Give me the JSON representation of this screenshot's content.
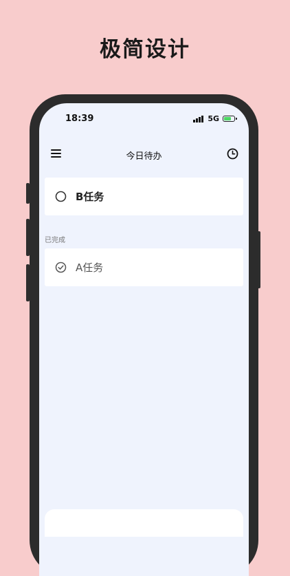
{
  "headline": "极简设计",
  "status_bar": {
    "time": "18:39",
    "network": "5G"
  },
  "app_bar": {
    "title": "今日待办"
  },
  "todo": {
    "items": [
      {
        "label": "B任务"
      }
    ]
  },
  "completed": {
    "section_label": "已完成",
    "items": [
      {
        "label": "A任务"
      }
    ]
  },
  "colors": {
    "background": "#f8cccc",
    "screen": "#eff3fd",
    "card": "#ffffff",
    "battery_fill": "#4cd964"
  },
  "icons": {
    "menu": "hamburger-menu-icon",
    "history": "clock-icon",
    "todo": "empty-circle-icon",
    "completed": "check-circle-icon"
  }
}
